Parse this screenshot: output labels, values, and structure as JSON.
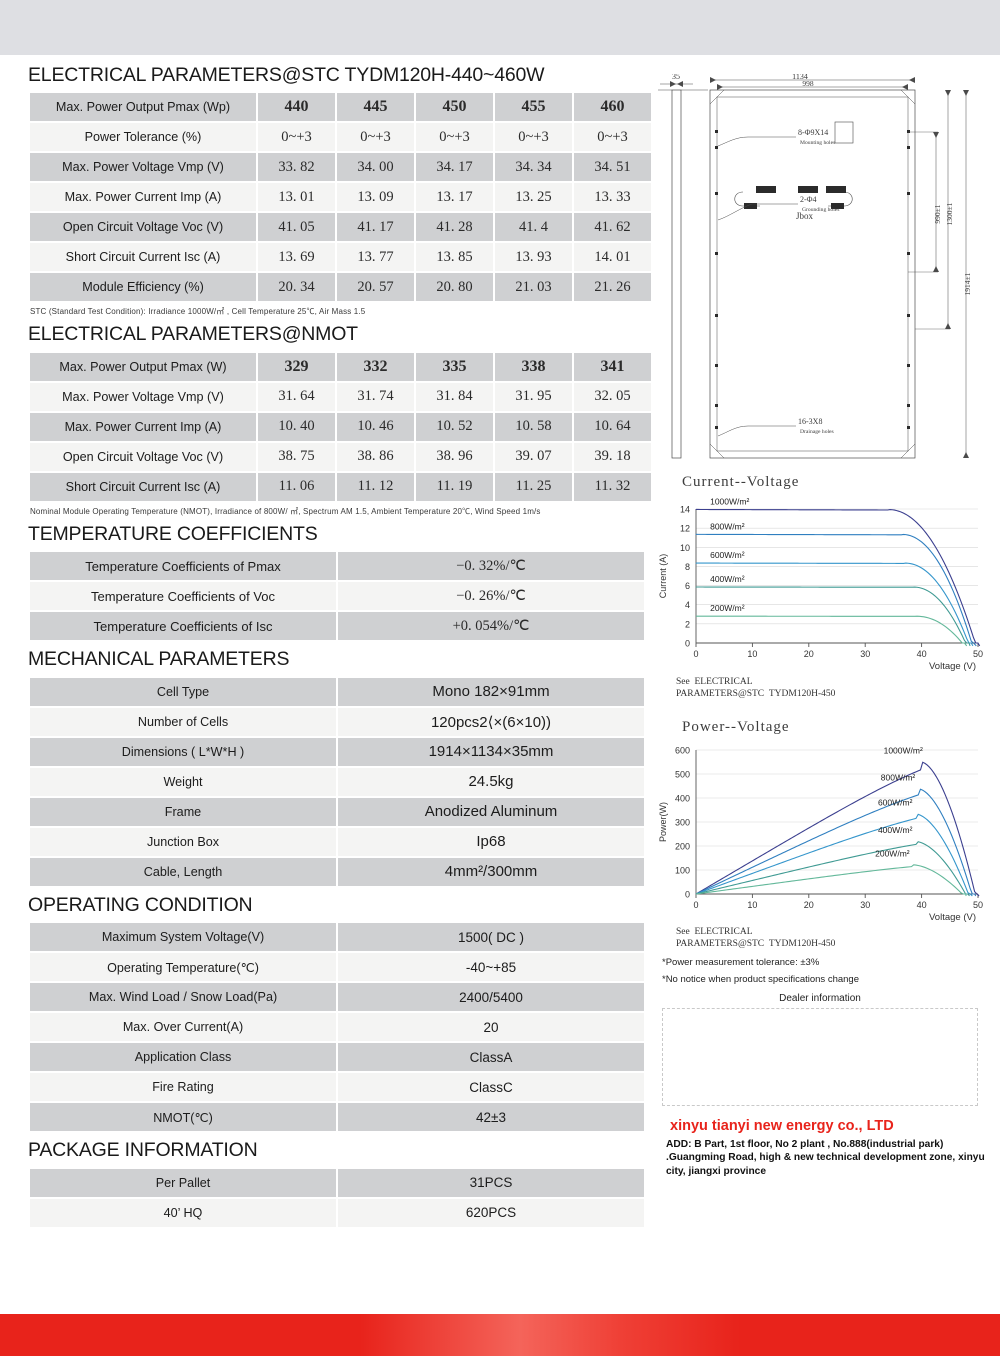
{
  "doc": {
    "title": "ELECTRICAL PARAMETERS@STC TYDM120H-440~460W"
  },
  "sections": {
    "stc_heading": "ELECTRICAL PARAMETERS@STC TYDM120H-440~460W",
    "nmot_heading": "ELECTRICAL PARAMETERS@NMOT",
    "temp_heading": "TEMPERATURE COEFFICIENTS",
    "mech_heading": "MECHANICAL PARAMETERS",
    "oper_heading": "OPERATING CONDITION",
    "pkg_heading": "PACKAGE INFORMATION"
  },
  "stc_table": {
    "note": "STC (Standard Test Condition): Irradiance 1000W/㎡ , Cell Temperature 25℃, Air Mass 1.5",
    "rows": [
      {
        "label": "Max. Power Output Pmax (Wp)",
        "values": [
          "440",
          "445",
          "450",
          "455",
          "460"
        ]
      },
      {
        "label": "Power Tolerance (%)",
        "values": [
          "0~+3",
          "0~+3",
          "0~+3",
          "0~+3",
          "0~+3"
        ]
      },
      {
        "label": "Max. Power Voltage Vmp (V)",
        "values": [
          "33. 82",
          "34. 00",
          "34. 17",
          "34. 34",
          "34. 51"
        ]
      },
      {
        "label": "Max. Power Current Imp (A)",
        "values": [
          "13. 01",
          "13. 09",
          "13. 17",
          "13. 25",
          "13. 33"
        ]
      },
      {
        "label": "Open Circuit Voltage Voc (V)",
        "values": [
          "41. 05",
          "41. 17",
          "41. 28",
          "41. 4",
          "41. 62"
        ]
      },
      {
        "label": "Short Circuit Current Isc (A)",
        "values": [
          "13. 69",
          "13. 77",
          "13. 85",
          "13. 93",
          "14. 01"
        ]
      },
      {
        "label": "Module Efficiency (%)",
        "values": [
          "20. 34",
          "20. 57",
          "20. 80",
          "21. 03",
          "21. 26"
        ]
      }
    ]
  },
  "nmot_table": {
    "note": "Nominal Module Operating Temperature (NMOT), Irradiance of 800W/ ㎡, Spectrum AM 1.5, Ambient Temperature 20℃, Wind Speed 1m/s",
    "rows": [
      {
        "label": "Max. Power Output Pmax (W)",
        "values": [
          "329",
          "332",
          "335",
          "338",
          "341"
        ]
      },
      {
        "label": "Max. Power Voltage Vmp (V)",
        "values": [
          "31. 64",
          "31. 74",
          "31. 84",
          "31. 95",
          "32. 05"
        ]
      },
      {
        "label": "Max. Power Current Imp (A)",
        "values": [
          "10. 40",
          "10. 46",
          "10. 52",
          "10. 58",
          "10. 64"
        ]
      },
      {
        "label": "Open Circuit Voltage Voc (V)",
        "values": [
          "38. 75",
          "38. 86",
          "38. 96",
          "39. 07",
          "39. 18"
        ]
      },
      {
        "label": "Short Circuit Current Isc (A)",
        "values": [
          "11. 06",
          "11. 12",
          "11. 19",
          "11. 25",
          "11. 32"
        ]
      }
    ]
  },
  "temp_table": {
    "rows": [
      {
        "label": "Temperature Coefficients of Pmax",
        "value": "−0. 32%/℃"
      },
      {
        "label": "Temperature Coefficients of Voc",
        "value": "−0. 26%/℃"
      },
      {
        "label": "Temperature Coefficients of Isc",
        "value": "+0. 054%/℃"
      }
    ]
  },
  "mech_table": {
    "rows": [
      {
        "label": "Cell Type",
        "value": "Mono 182×91mm"
      },
      {
        "label": "Number of Cells",
        "value": "120pcs2⟨×(6×10))"
      },
      {
        "label": "Dimensions ( L*W*H )",
        "value": "1914×1134×35mm"
      },
      {
        "label": "Weight",
        "value": "24.5kg"
      },
      {
        "label": "Frame",
        "value": "Anodized Aluminum"
      },
      {
        "label": "Junction Box",
        "value": "Ip68"
      },
      {
        "label": "Cable, Length",
        "value": "4mm²/300mm"
      }
    ]
  },
  "oper_table": {
    "rows": [
      {
        "label": "Maximum System Voltage(V)",
        "value": "1500( DC )"
      },
      {
        "label": "Operating Temperature(℃)",
        "value": "-40~+85"
      },
      {
        "label": "Max. Wind Load / Snow Load(Pa)",
        "value": "2400/5400"
      },
      {
        "label": "Max. Over Current(A)",
        "value": "20"
      },
      {
        "label": "Application Class",
        "value": "ClassA"
      },
      {
        "label": "Fire Rating",
        "value": "ClassC"
      },
      {
        "label": "NMOT(℃)",
        "value": "42±3"
      }
    ]
  },
  "pkg_table": {
    "rows": [
      {
        "label": "Per Pallet",
        "value": "31PCS"
      },
      {
        "label": "40’ HQ",
        "value": "620PCS"
      }
    ]
  },
  "drawing": {
    "side_thickness": "35",
    "width_outer": "1134",
    "width_inner": "998",
    "mounting_holes": "8-Φ9X14",
    "mounting_holes_sub": "Mounting holes",
    "grounding_holes": "2-Φ4",
    "grounding_holes_sub": "Grounding holes",
    "drainage_holes": "16-3X8",
    "drainage_holes_sub": "Drainage holes",
    "jbox": "Jbox",
    "dim_990": "990±1",
    "dim_1300": "1300±1",
    "dim_1914": "1914±1"
  },
  "chart_data": [
    {
      "type": "line",
      "title": "Current--Voltage",
      "xlabel": "Voltage (V)",
      "ylabel": "Current (A)",
      "xlim": [
        0,
        50
      ],
      "ylim": [
        0,
        14
      ],
      "xticks": [
        "0",
        "10",
        "20",
        "30",
        "40",
        "50"
      ],
      "yticks": [
        "0",
        "2",
        "4",
        "6",
        "8",
        "10",
        "12",
        "14"
      ],
      "grid": true,
      "legend_position": "inline-left",
      "footnote": "See ELECTRICAL\nPARAMETERS@STC TYDM120H-450",
      "series": [
        {
          "name": "1000W/m²",
          "color": "#3b3f8f",
          "isc": 13.95,
          "vknee": 34,
          "voc": 49.5
        },
        {
          "name": "800W/m²",
          "color": "#2f7fc0",
          "isc": 11.35,
          "vknee": 36.5,
          "voc": 48.9
        },
        {
          "name": "600W/m²",
          "color": "#3596cc",
          "isc": 8.35,
          "vknee": 37.0,
          "voc": 48.3
        },
        {
          "name": "400W/m²",
          "color": "#3f9a93",
          "isc": 5.85,
          "vknee": 38.5,
          "voc": 47.8
        },
        {
          "name": "200W/m²",
          "color": "#63b89a",
          "isc": 2.8,
          "vknee": 39.0,
          "voc": 47.2
        }
      ]
    },
    {
      "type": "line",
      "title": "Power--Voltage",
      "xlabel": "Voltage (V)",
      "ylabel": "Power(W)",
      "xlim": [
        0,
        50
      ],
      "ylim": [
        0,
        600
      ],
      "xticks": [
        "0",
        "10",
        "20",
        "30",
        "40",
        "50"
      ],
      "yticks": [
        "0",
        "100",
        "200",
        "300",
        "400",
        "500",
        "600"
      ],
      "grid": true,
      "legend_position": "inline-right",
      "footnote": "See ELECTRICAL\nPARAMETERS@STC TYDM120H-450",
      "series": [
        {
          "name": "1000W/m²",
          "color": "#3b3f8f",
          "pmax": 552,
          "vmp": 40.0,
          "voc": 49.5
        },
        {
          "name": "800W/m²",
          "color": "#2f7fc0",
          "pmax": 440,
          "vmp": 39.5,
          "voc": 48.9
        },
        {
          "name": "600W/m²",
          "color": "#3596cc",
          "pmax": 335,
          "vmp": 39.0,
          "voc": 48.3
        },
        {
          "name": "400W/m²",
          "color": "#3f9a93",
          "pmax": 220,
          "vmp": 39.0,
          "voc": 47.8
        },
        {
          "name": "200W/m²",
          "color": "#63b89a",
          "pmax": 122,
          "vmp": 38.5,
          "voc": 47.2
        }
      ]
    }
  ],
  "footer": {
    "tolerance_note": "*Power measurement tolerance: ±3%",
    "change_note": "*No notice when product specifications change",
    "dealer_title": "Dealer information",
    "company": "xinyu tianyi new energy co., LTD",
    "address": "ADD: B Part, 1st floor, No 2 plant , No.888(industrial park) .Guangming Road, high & new technical development zone, xinyu city, jiangxi province"
  },
  "colors": {
    "brand_red": "#e8231b",
    "table_dark": "#cfd0d2",
    "table_light": "#f4f4f3",
    "top_band": "#dedfe3"
  }
}
